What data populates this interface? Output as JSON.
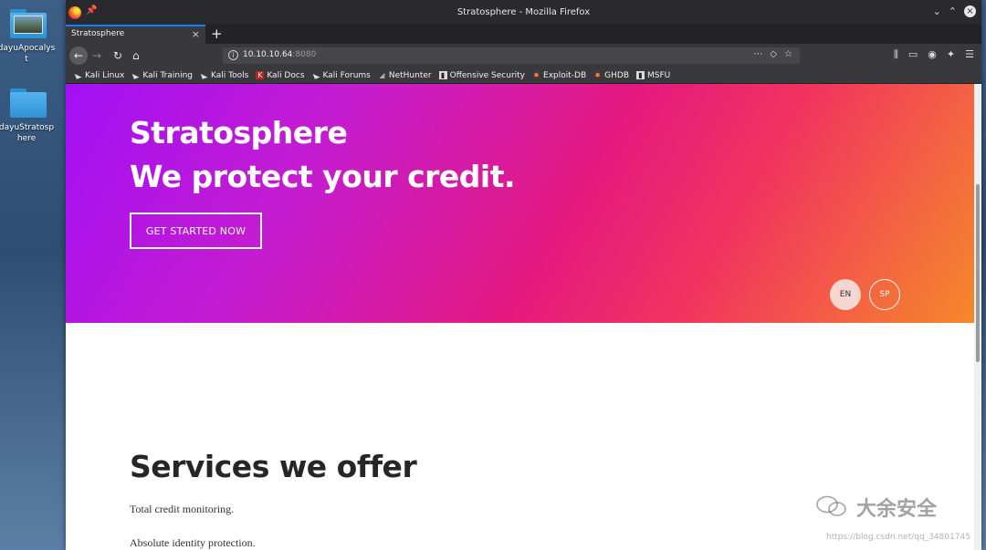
{
  "desktop": {
    "icons": [
      {
        "label": "dayuApocalyst"
      },
      {
        "label": "dayuStratosphere"
      }
    ]
  },
  "browser": {
    "window_title": "Stratosphere - Mozilla Firefox",
    "tab_title": "Stratosphere",
    "url_host": "10.10.10.64",
    "url_port": ":8080",
    "bookmarks": [
      {
        "label": "Kali Linux",
        "icon": "kali-dragon-icon"
      },
      {
        "label": "Kali Training",
        "icon": "kali-dragon-icon"
      },
      {
        "label": "Kali Tools",
        "icon": "kali-dragon-icon"
      },
      {
        "label": "Kali Docs",
        "icon": "kali-docs-icon"
      },
      {
        "label": "Kali Forums",
        "icon": "kali-dragon-icon"
      },
      {
        "label": "NetHunter",
        "icon": "nethunter-icon"
      },
      {
        "label": "Offensive Security",
        "icon": "offsec-icon"
      },
      {
        "label": "Exploit-DB",
        "icon": "exploitdb-icon"
      },
      {
        "label": "GHDB",
        "icon": "ghdb-icon"
      },
      {
        "label": "MSFU",
        "icon": "msfu-icon"
      }
    ]
  },
  "page": {
    "hero_title": "Stratosphere",
    "hero_tagline": "We protect your credit.",
    "cta_label": "GET STARTED NOW",
    "lang_en": "EN",
    "lang_sp": "SP",
    "services_heading": "Services we offer",
    "services_items": [
      "Total credit monitoring.",
      "Absolute identity protection."
    ]
  },
  "watermark": {
    "brand": "大余安全",
    "url": "https://blog.csdn.net/qq_34801745"
  },
  "colors": {
    "hero_gradient": [
      "#a210f5",
      "#c51cd0",
      "#e4197f",
      "#f1355e",
      "#f5892a"
    ],
    "chrome_dark": "#2a2a2e",
    "accent_tab": "#0a84ff"
  }
}
